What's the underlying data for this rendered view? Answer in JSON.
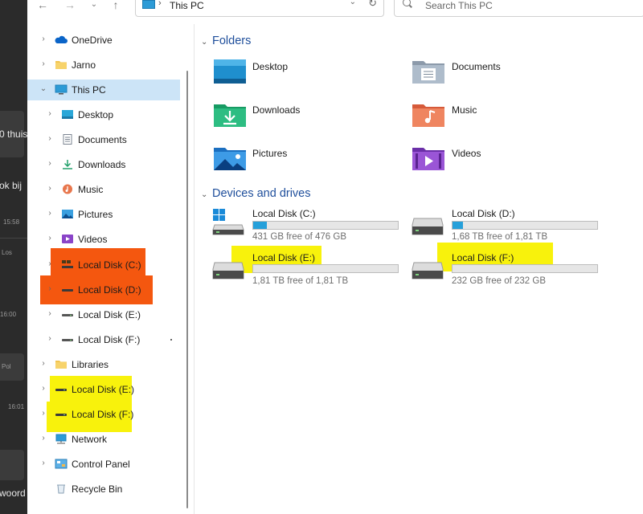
{
  "background_window": {
    "fragments": [
      "0 thuis",
      "ok bij",
      "15:58",
      "Los",
      "16:00",
      "Pol",
      "16:01",
      "woord"
    ]
  },
  "nav": {
    "back_icon": "arrow-left-icon",
    "forward_icon": "arrow-right-icon",
    "recent_icon": "chevron-down-icon",
    "up_icon": "arrow-up-icon"
  },
  "address_bar": {
    "path": "This PC"
  },
  "search": {
    "placeholder": "Search This PC"
  },
  "sidebar": {
    "items": [
      {
        "label": "OneDrive",
        "icon": "cloud-icon"
      },
      {
        "label": "Jarno",
        "icon": "folder-icon"
      },
      {
        "label": "This PC",
        "icon": "computer-icon",
        "selected": true
      },
      {
        "label": "Desktop",
        "icon": "desktop-icon"
      },
      {
        "label": "Documents",
        "icon": "documents-icon"
      },
      {
        "label": "Downloads",
        "icon": "download-icon"
      },
      {
        "label": "Music",
        "icon": "music-icon"
      },
      {
        "label": "Pictures",
        "icon": "pictures-icon"
      },
      {
        "label": "Videos",
        "icon": "video-icon"
      },
      {
        "label": "Local Disk (C:)",
        "icon": "drive-icon",
        "highlight": "#f4570f"
      },
      {
        "label": "Local Disk (D:)",
        "icon": "drive-icon",
        "highlight": "#f4570f"
      },
      {
        "label": "Local Disk (E:)",
        "icon": "drive-icon"
      },
      {
        "label": "Local Disk (F:)",
        "icon": "drive-icon"
      },
      {
        "label": "Libraries",
        "icon": "folder-icon"
      },
      {
        "label": "Local Disk (E:)",
        "icon": "drive-icon",
        "highlight": "#f8f20c"
      },
      {
        "label": "Local Disk (F:)",
        "icon": "drive-icon",
        "highlight": "#f8f20c"
      },
      {
        "label": "Network",
        "icon": "network-icon"
      },
      {
        "label": "Control Panel",
        "icon": "control-panel-icon"
      },
      {
        "label": "Recycle Bin",
        "icon": "recycle-bin-icon"
      }
    ]
  },
  "content": {
    "folders_header": "Folders",
    "folders": [
      {
        "label": "Desktop",
        "icon": "desktop-folder-icon"
      },
      {
        "label": "Documents",
        "icon": "documents-folder-icon"
      },
      {
        "label": "Downloads",
        "icon": "downloads-folder-icon"
      },
      {
        "label": "Music",
        "icon": "music-folder-icon"
      },
      {
        "label": "Pictures",
        "icon": "pictures-folder-icon"
      },
      {
        "label": "Videos",
        "icon": "videos-folder-icon"
      }
    ],
    "drives_header": "Devices and drives",
    "drives": [
      {
        "label": "Local Disk (C:)",
        "free": "431 GB free of 476 GB",
        "used_fraction": 0.095,
        "icon": "windows-drive-icon"
      },
      {
        "label": "Local Disk (D:)",
        "free": "1,68 TB free of 1,81 TB",
        "used_fraction": 0.07,
        "icon": "drive-icon"
      },
      {
        "label": "Local Disk (E:)",
        "free": "1,81 TB free of 1,81 TB",
        "used_fraction": 0.0,
        "icon": "drive-icon",
        "highlight": "#f8f20c"
      },
      {
        "label": "Local Disk (F:)",
        "free": "232 GB free of 232 GB",
        "used_fraction": 0.0,
        "icon": "drive-icon",
        "highlight": "#f8f20c"
      }
    ]
  },
  "colors": {
    "accent": "#26a0da",
    "selected_bg": "#cce4f7",
    "header_blue": "#1e4e9b",
    "orange_mark": "#f4570f",
    "yellow_mark": "#f8f20c"
  }
}
